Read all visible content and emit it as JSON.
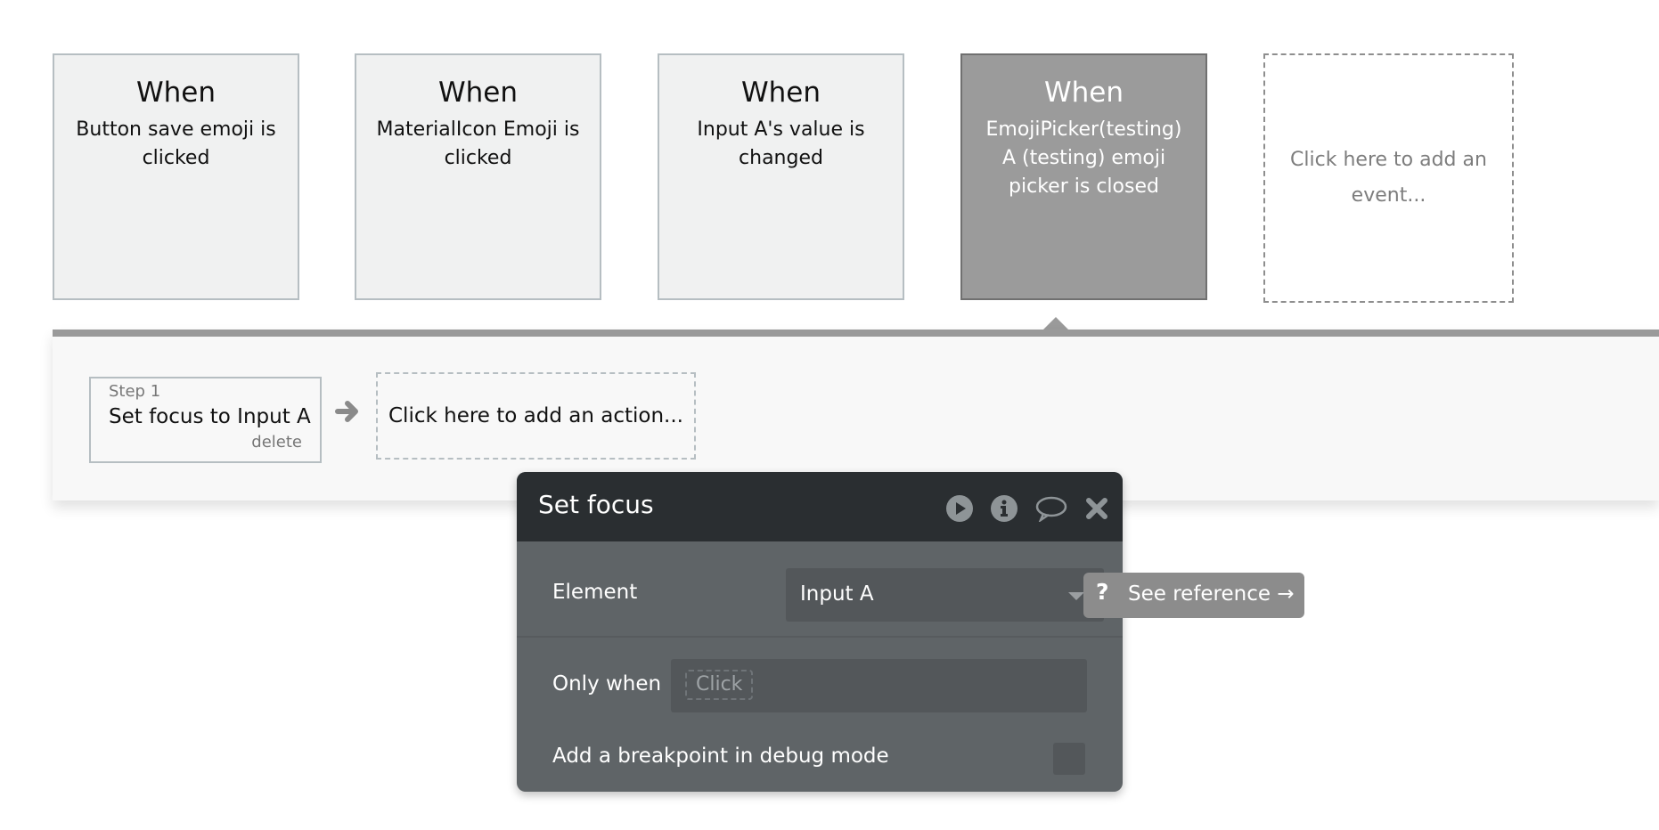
{
  "events": [
    {
      "when": "When",
      "description": "Button save emoji is clicked",
      "selected": false
    },
    {
      "when": "When",
      "description": "MaterialIcon Emoji is clicked",
      "selected": false
    },
    {
      "when": "When",
      "description": "Input A's value is changed",
      "selected": false
    },
    {
      "when": "When",
      "description": "EmojiPicker(testing) A (testing) emoji picker is closed",
      "selected": true
    }
  ],
  "add_event_label": "Click here to add an event...",
  "workflow": {
    "steps": [
      {
        "label": "Step 1",
        "title": "Set focus to Input A",
        "delete_label": "delete"
      }
    ],
    "add_action_label": "Click here to add an action..."
  },
  "dialog": {
    "title": "Set focus",
    "icons": [
      "play-icon",
      "info-icon",
      "comment-icon",
      "close-icon"
    ],
    "element_label": "Element",
    "element_value": "Input A",
    "only_when_label": "Only when",
    "only_when_placeholder": "Click",
    "breakpoint_label": "Add a breakpoint in debug mode",
    "breakpoint_checked": false
  },
  "reference_button": {
    "icon": "?",
    "label": "See reference →"
  },
  "colors": {
    "selected_event": "#9b9b9b",
    "dialog_header": "#2a2e31",
    "dialog_body": "#5f6467",
    "panel_bar": "#9a9a9a"
  }
}
